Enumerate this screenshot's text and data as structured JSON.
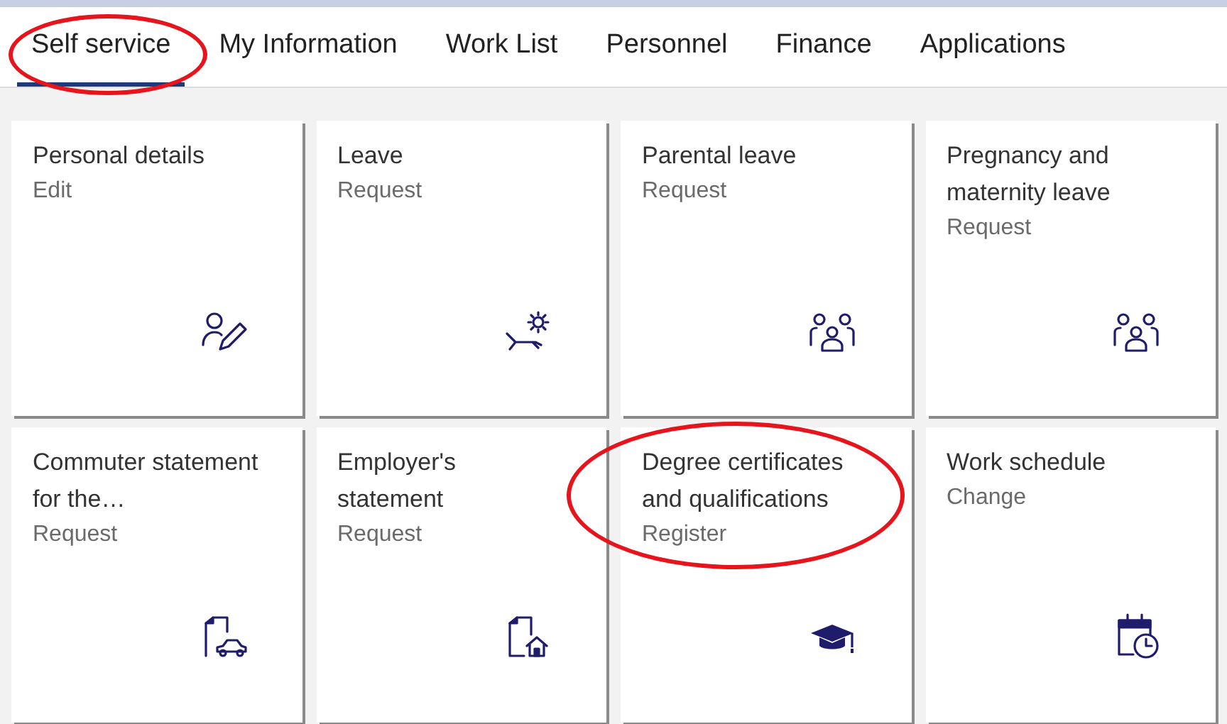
{
  "tabs": [
    {
      "label": "Self service",
      "selected": true,
      "circled": true
    },
    {
      "label": "My Information",
      "selected": false,
      "circled": false
    },
    {
      "label": "Work List",
      "selected": false,
      "circled": false
    },
    {
      "label": "Personnel",
      "selected": false,
      "circled": false
    },
    {
      "label": "Finance",
      "selected": false,
      "circled": false
    },
    {
      "label": "Applications",
      "selected": false,
      "circled": false
    }
  ],
  "tiles": [
    {
      "title": "Personal details",
      "subtitle": "Edit",
      "circled": false
    },
    {
      "title": "Leave",
      "subtitle": "Request",
      "circled": false
    },
    {
      "title": "Parental leave",
      "subtitle": "Request",
      "circled": false
    },
    {
      "title": "Pregnancy and maternity leave",
      "subtitle": "Request",
      "circled": false
    },
    {
      "title": "Commuter statement for the…",
      "subtitle": "Request",
      "circled": false
    },
    {
      "title": "Employer's statement",
      "subtitle": "Request",
      "circled": false
    },
    {
      "title": "Degree certificates and qualifications",
      "subtitle": "Register",
      "circled": true
    },
    {
      "title": "Work schedule",
      "subtitle": "Change",
      "circled": false
    }
  ]
}
